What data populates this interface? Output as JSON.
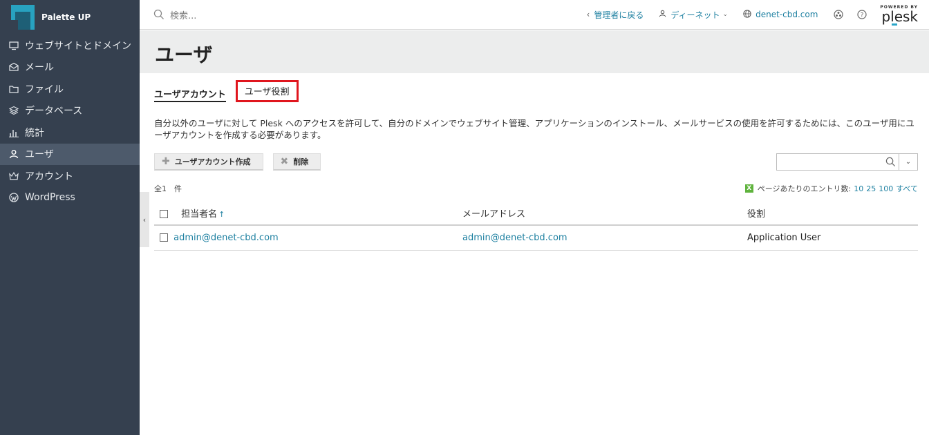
{
  "brand": {
    "name": "Palette UP"
  },
  "sidebar": {
    "items": [
      {
        "label": "ウェブサイトとドメイン",
        "icon": "monitor-icon"
      },
      {
        "label": "メール",
        "icon": "mail-icon"
      },
      {
        "label": "ファイル",
        "icon": "folder-icon"
      },
      {
        "label": "データベース",
        "icon": "database-icon"
      },
      {
        "label": "統計",
        "icon": "bar-chart-icon"
      },
      {
        "label": "ユーザ",
        "icon": "user-icon",
        "active": true
      },
      {
        "label": "アカウント",
        "icon": "crown-icon"
      },
      {
        "label": "WordPress",
        "icon": "wordpress-icon"
      }
    ]
  },
  "header": {
    "search_placeholder": "検索...",
    "back_admin": "管理者に戻る",
    "user_name": "ディーネット",
    "domain": "denet-cbd.com",
    "powered_by": "POWERED BY",
    "plesk": "plesk"
  },
  "page": {
    "title": "ユーザ",
    "tabs": [
      {
        "label": "ユーザアカウント",
        "active": true
      },
      {
        "label": "ユーザ役割",
        "highlighted": true
      }
    ],
    "description": "自分以外のユーザに対して Plesk へのアクセスを許可して、自分のドメインでウェブサイト管理、アプリケーションのインストール、メールサービスの使用を許可するためには、このユーザ用にユーザアカウントを作成する必要があります。",
    "toolbar": {
      "create_label": "ユーザアカウント作成",
      "delete_label": "削除"
    },
    "total": "全1　件",
    "per_page_label": "ページあたりのエントリ数:",
    "per_page_options": [
      "10",
      "25",
      "100",
      "すべて"
    ],
    "table": {
      "headers": [
        "担当者名",
        "メールアドレス",
        "役割"
      ],
      "rows": [
        {
          "name": "admin@denet-cbd.com",
          "email": "admin@denet-cbd.com",
          "role": "Application User"
        }
      ]
    }
  },
  "colors": {
    "sidebar": "#35404f",
    "accent": "#1c7fa0",
    "highlight": "#e0161e"
  }
}
